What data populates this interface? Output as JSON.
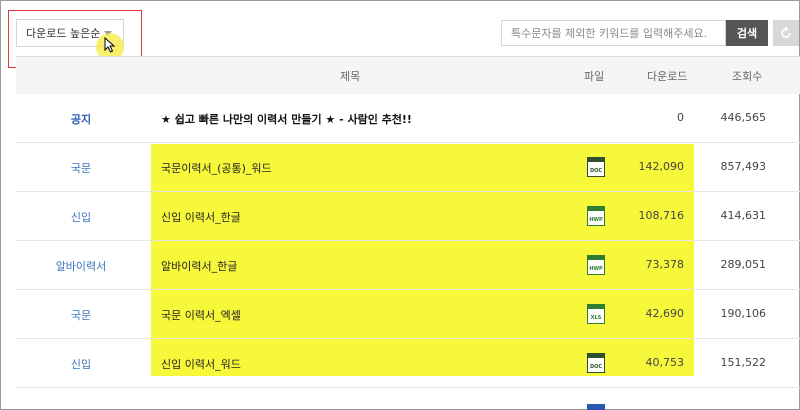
{
  "toolbar": {
    "sort_label": "다운로드 높은순",
    "search_placeholder": "특수문자를 제외한 키워드를 입력해주세요.",
    "search_button": "검색"
  },
  "table": {
    "headers": {
      "title": "제목",
      "file": "파일",
      "downloads": "다운로드",
      "views": "조회수"
    },
    "rows": [
      {
        "category": "공지",
        "title": "★ 쉽고 빠른 나만의 이력서 만들기 ★ - 사람인 추천!!",
        "file_type": "",
        "downloads": "0",
        "views": "446,565"
      },
      {
        "category": "국문",
        "title": "국문이력서_(공통)_워드",
        "file_type": "DOC",
        "downloads": "142,090",
        "views": "857,493"
      },
      {
        "category": "신입",
        "title": "신입 이력서_한글",
        "file_type": "HWP",
        "downloads": "108,716",
        "views": "414,631"
      },
      {
        "category": "알바이력서",
        "title": "알바이력서_한글",
        "file_type": "HWP",
        "downloads": "73,378",
        "views": "289,051"
      },
      {
        "category": "국문",
        "title": "국문 이력서_엑셀",
        "file_type": "XLS",
        "downloads": "42,690",
        "views": "190,106"
      },
      {
        "category": "신입",
        "title": "신입 이력서_워드",
        "file_type": "DOC",
        "downloads": "40,753",
        "views": "151,522"
      }
    ]
  },
  "colors": {
    "accent": "#3c73c0",
    "highlight": "#f8f83a",
    "annotation_border": "#e0333a",
    "search_button_bg": "#555555"
  },
  "icons": {
    "sort": "chevron-down-icon",
    "refresh": "refresh-icon",
    "doc": "doc-file-icon",
    "hwp": "hwp-file-icon",
    "xls": "xls-file-icon"
  }
}
